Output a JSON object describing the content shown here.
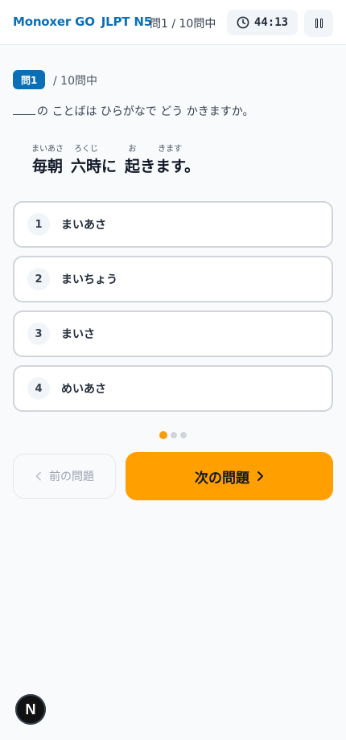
{
  "header": {
    "brand": "Monoxer GO",
    "level": "JLPT N5",
    "progress": "問1 / 10問中",
    "timer": "44:13"
  },
  "question": {
    "badge": "問1",
    "total": "/ 10問中",
    "prompt": "の ことばは ひらがなで どう かきますか。",
    "sentence": [
      {
        "text": "毎朝",
        "ruby": "まいあさ"
      },
      {
        "text": "六時",
        "ruby": "ろくじ"
      },
      {
        "text": "に",
        "ruby": ""
      },
      {
        "text": "起",
        "ruby": "お"
      },
      {
        "text": "きます。",
        "ruby": "きます"
      }
    ]
  },
  "options": [
    {
      "num": "1",
      "label": "まいあさ"
    },
    {
      "num": "2",
      "label": "まいちょう"
    },
    {
      "num": "3",
      "label": "まいさ"
    },
    {
      "num": "4",
      "label": "めいあさ"
    }
  ],
  "nav": {
    "prev_label": "前の問題",
    "next_label": "次の問題"
  },
  "avatar": "N",
  "colors": {
    "brand": "#0b6fb8",
    "accent": "#ff9f00"
  }
}
